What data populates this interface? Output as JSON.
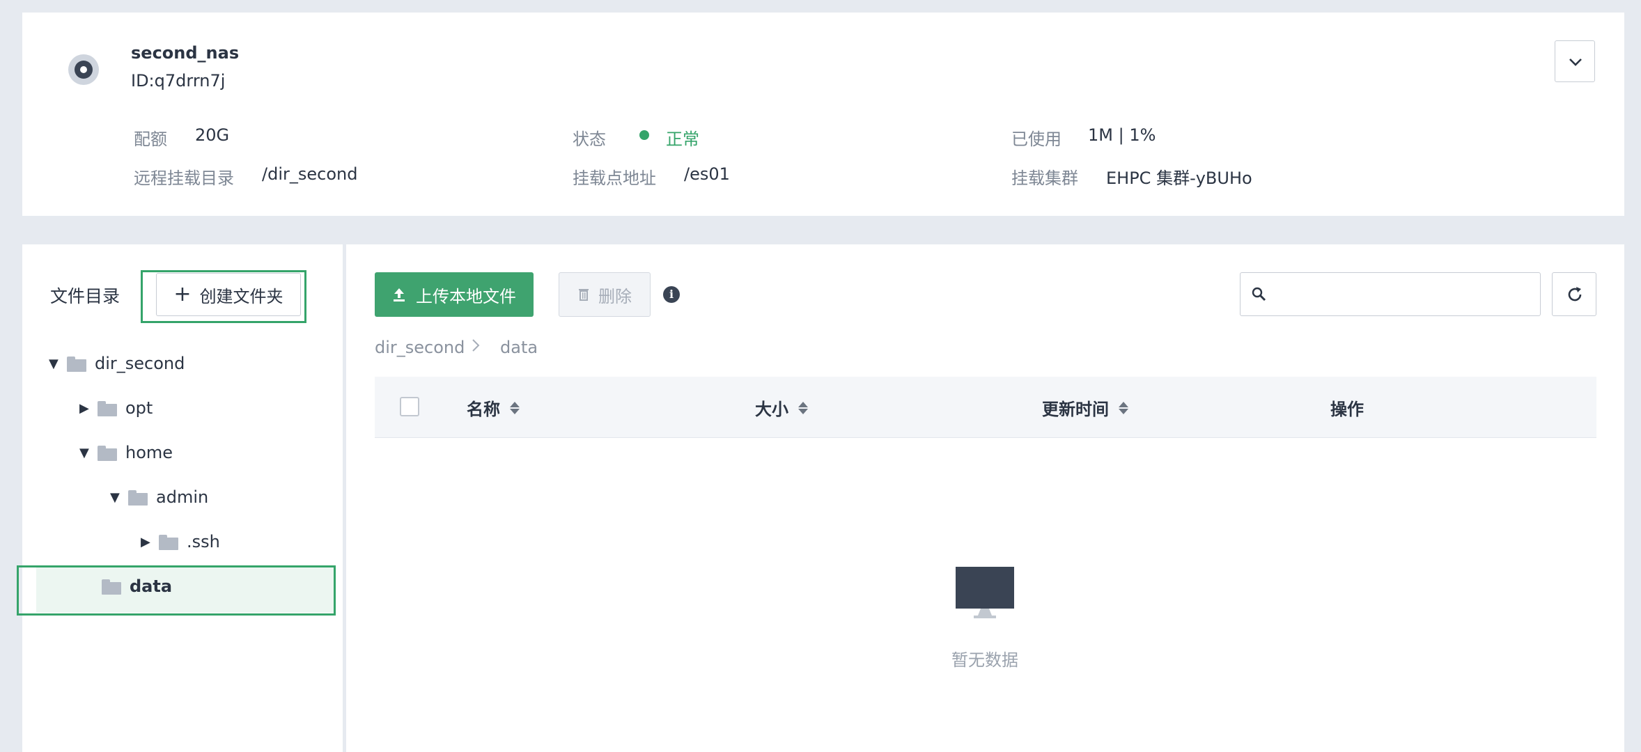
{
  "nas": {
    "name": "second_nas",
    "id": "ID:q7drrn7j",
    "icon": "storage-disk-icon"
  },
  "info": {
    "quota_label": "配额",
    "quota_value": "20G",
    "status_label": "状态",
    "status_value": "正常",
    "status_color": "#35a46a",
    "used_label": "已使用",
    "used_value": "1M | 1%",
    "remote_dir_label": "远程挂载目录",
    "remote_dir_value": "/dir_second",
    "mount_addr_label": "挂载点地址",
    "mount_addr_value": "/es01",
    "mount_cluster_label": "挂载集群",
    "mount_cluster_value": "EHPC 集群-yBUHo"
  },
  "sidebar": {
    "title": "文件目录",
    "create_folder_label": "创建文件夹",
    "tree": [
      {
        "label": "dir_second",
        "expanded": true
      },
      {
        "label": "opt",
        "expanded": false
      },
      {
        "label": "home",
        "expanded": true
      },
      {
        "label": "admin",
        "expanded": true
      },
      {
        "label": ".ssh",
        "expanded": false
      },
      {
        "label": "data",
        "selected": true
      }
    ]
  },
  "toolbar": {
    "upload_label": "上传本地文件",
    "delete_label": "删除",
    "search_placeholder": ""
  },
  "breadcrumb": [
    "dir_second",
    "data"
  ],
  "table": {
    "columns": [
      "名称",
      "大小",
      "更新时间",
      "操作"
    ],
    "rows": [],
    "empty_text": "暂无数据"
  },
  "colors": {
    "accent": "#3fa36f",
    "highlight_border": "#35a46a",
    "page_bg": "#e6eaf0"
  }
}
